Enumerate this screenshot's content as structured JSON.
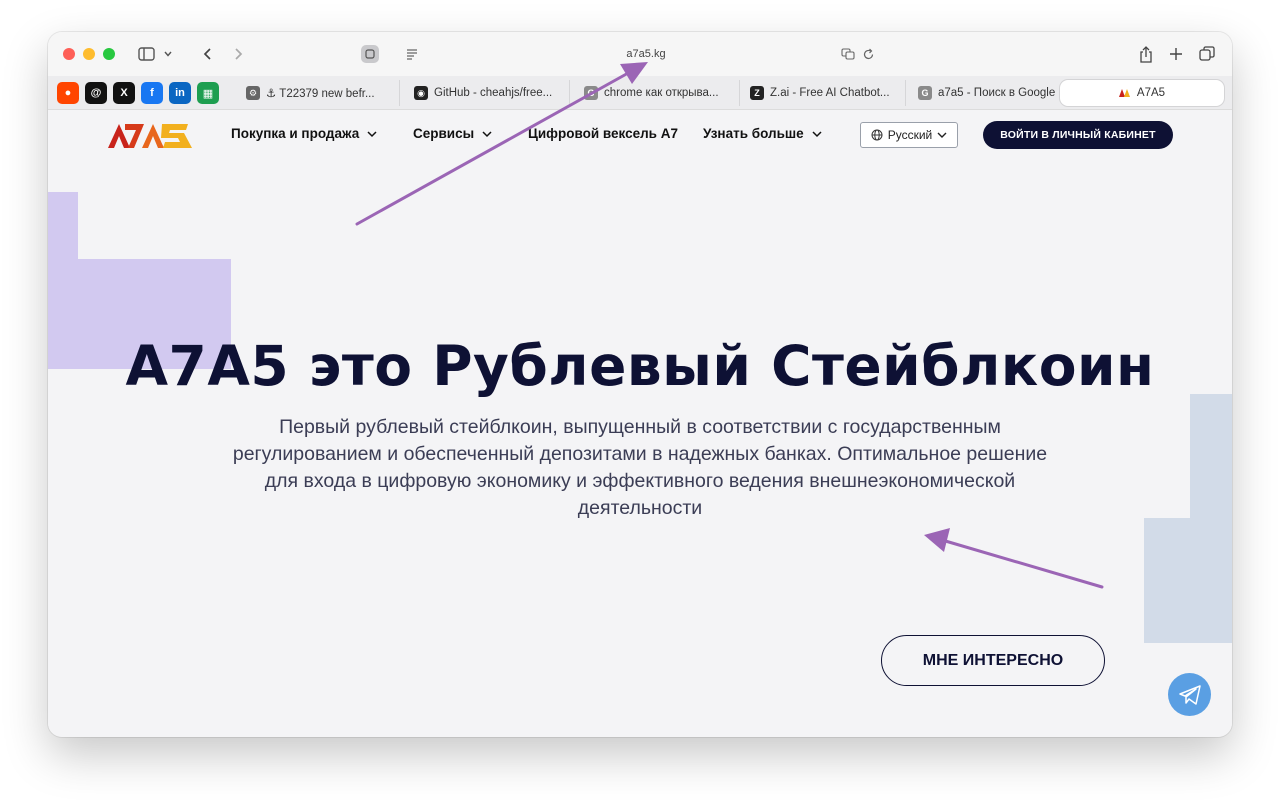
{
  "browser": {
    "address": "a7a5.kg",
    "pinned": [
      {
        "icon": "reddit-icon",
        "color": "#ff4500",
        "glyph": "●"
      },
      {
        "icon": "threads-icon",
        "color": "#111111",
        "glyph": "@"
      },
      {
        "icon": "x-icon",
        "color": "#111111",
        "glyph": "X"
      },
      {
        "icon": "facebook-icon",
        "color": "#1877f2",
        "glyph": "f"
      },
      {
        "icon": "linkedin-icon",
        "color": "#0a66c2",
        "glyph": "in"
      },
      {
        "icon": "sheets-icon",
        "color": "#1e9e50",
        "glyph": "▦"
      }
    ],
    "tabs": [
      {
        "label": "⚓ T22379 new befr...",
        "icon": "gear-icon",
        "color": "#666666",
        "glyph": "⚙"
      },
      {
        "label": "GitHub - cheahjs/free...",
        "icon": "github-icon",
        "color": "#222222",
        "glyph": "◉"
      },
      {
        "label": "chrome как открыва...",
        "icon": "google-icon",
        "color": "#8a8a8a",
        "glyph": "G"
      },
      {
        "label": "Z.ai - Free AI Chatbot...",
        "icon": "zai-icon",
        "color": "#222222",
        "glyph": "Z"
      },
      {
        "label": "a7a5 - Поиск в Google",
        "icon": "google-icon",
        "color": "#8a8a8a",
        "glyph": "G"
      },
      {
        "label": "A7A5",
        "icon": "a7a5-icon",
        "color": "#e23b1d",
        "glyph": ""
      }
    ]
  },
  "site": {
    "nav": {
      "buy_sell": "Покупка и продажа",
      "services": "Сервисы",
      "digital_bill": "Цифровой вексель А7",
      "learn_more": "Узнать больше",
      "language": "Русский",
      "login": "ВОЙТИ В ЛИЧНЫЙ КАБИНЕТ"
    },
    "hero": {
      "title": "A7A5 это Рублевый Стейблкоин",
      "subtitle": "Первый рублевый стейблкоин, выпущенный в соответствии с государственным регулированием и обеспеченный депозитами в надежных банках. Оптимальное решение для входа в цифровую экономику и эффективного ведения внешнеэкономической деятельности",
      "cta": "МНЕ ИНТЕРЕСНО"
    },
    "colors": {
      "brand_dark": "#0e1134",
      "deco_purple": "#d2c9f0",
      "deco_blue": "#d2dbe8",
      "annotation": "#9b65b5"
    }
  }
}
